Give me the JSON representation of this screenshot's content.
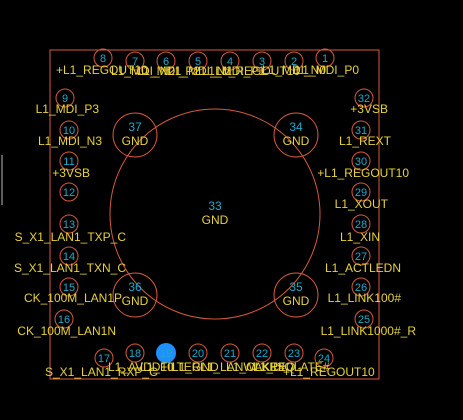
{
  "pins": [
    {
      "num": "1",
      "net": "L1_MDI_P0"
    },
    {
      "num": "2",
      "net": "L1_MDI_N0"
    },
    {
      "num": "3",
      "net": "L1_REGOUT10"
    },
    {
      "num": "4",
      "net": "L1_MDI_P1"
    },
    {
      "num": "5",
      "net": "L1_MDI_N1"
    },
    {
      "num": "6",
      "net": "L1_MDI_P2"
    },
    {
      "num": "7",
      "net": "L1_MDI_N2"
    },
    {
      "num": "8",
      "net": "+L1_REGOUT10"
    },
    {
      "num": "9",
      "net": "L1_MDI_P3"
    },
    {
      "num": "10",
      "net": "L1_MDI_N3"
    },
    {
      "num": "11",
      "net": "+3VSB"
    },
    {
      "num": "12",
      "net": ""
    },
    {
      "num": "13",
      "net": "S_X1_LAN1_TXP_C"
    },
    {
      "num": "14",
      "net": "S_X1_LAN1_TXN_C"
    },
    {
      "num": "15",
      "net": "CK_100M_LAN1P"
    },
    {
      "num": "16",
      "net": "CK_100M_LAN1N"
    },
    {
      "num": "17",
      "net": "S_X1_LAN1_RXP_C"
    },
    {
      "num": "18",
      "net": "L1_AVDD10"
    },
    {
      "num": "19",
      "net": "L1_FILTER"
    },
    {
      "num": "20",
      "net": "L1_GND"
    },
    {
      "num": "21",
      "net": "L1_LANWAKE#"
    },
    {
      "num": "22",
      "net": "L1_CLKREQ"
    },
    {
      "num": "23",
      "net": "L1_ISOLATE#"
    },
    {
      "num": "24",
      "net": "+L1_REGOUT10"
    },
    {
      "num": "25",
      "net": "L1_LINK1000#_R"
    },
    {
      "num": "26",
      "net": "L1_LINK100#"
    },
    {
      "num": "27",
      "net": "L1_ACTLEDN"
    },
    {
      "num": "28",
      "net": "L1_XIN"
    },
    {
      "num": "29",
      "net": "L1_XOUT"
    },
    {
      "num": "30",
      "net": "+L1_REGOUT10"
    },
    {
      "num": "31",
      "net": "L1_REXT"
    },
    {
      "num": "32",
      "net": "+3VSB"
    }
  ],
  "large_pads": [
    {
      "num": "33",
      "label": "GND"
    },
    {
      "num": "34",
      "label": "GND"
    },
    {
      "num": "35",
      "label": "GND"
    },
    {
      "num": "36",
      "label": "GND"
    },
    {
      "num": "37",
      "label": "GND"
    }
  ],
  "selected_pin": "19",
  "colors": {
    "outline": "#d45a3c",
    "pin_number": "#20a8c8",
    "net_label": "#e8d23a",
    "selection": "#1e90ff"
  }
}
